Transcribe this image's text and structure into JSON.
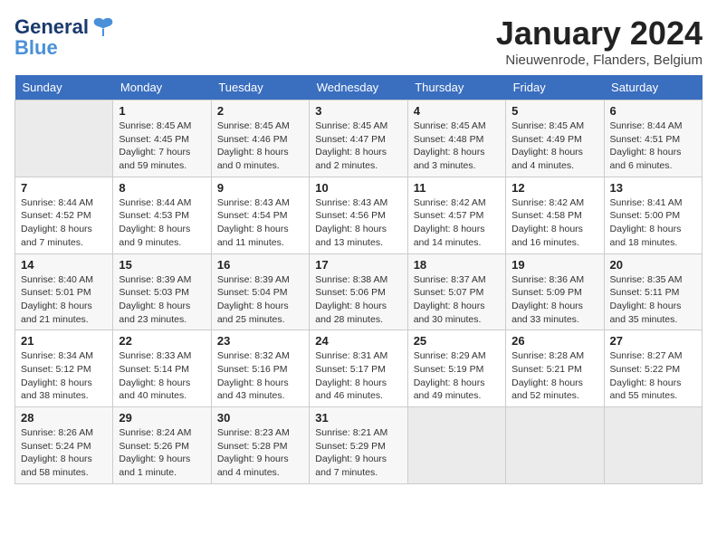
{
  "header": {
    "logo_line1": "General",
    "logo_line2": "Blue",
    "month_title": "January 2024",
    "location": "Nieuwenrode, Flanders, Belgium"
  },
  "days_of_week": [
    "Sunday",
    "Monday",
    "Tuesday",
    "Wednesday",
    "Thursday",
    "Friday",
    "Saturday"
  ],
  "weeks": [
    [
      {
        "num": "",
        "info": ""
      },
      {
        "num": "1",
        "info": "Sunrise: 8:45 AM\nSunset: 4:45 PM\nDaylight: 7 hours\nand 59 minutes."
      },
      {
        "num": "2",
        "info": "Sunrise: 8:45 AM\nSunset: 4:46 PM\nDaylight: 8 hours\nand 0 minutes."
      },
      {
        "num": "3",
        "info": "Sunrise: 8:45 AM\nSunset: 4:47 PM\nDaylight: 8 hours\nand 2 minutes."
      },
      {
        "num": "4",
        "info": "Sunrise: 8:45 AM\nSunset: 4:48 PM\nDaylight: 8 hours\nand 3 minutes."
      },
      {
        "num": "5",
        "info": "Sunrise: 8:45 AM\nSunset: 4:49 PM\nDaylight: 8 hours\nand 4 minutes."
      },
      {
        "num": "6",
        "info": "Sunrise: 8:44 AM\nSunset: 4:51 PM\nDaylight: 8 hours\nand 6 minutes."
      }
    ],
    [
      {
        "num": "7",
        "info": "Sunrise: 8:44 AM\nSunset: 4:52 PM\nDaylight: 8 hours\nand 7 minutes."
      },
      {
        "num": "8",
        "info": "Sunrise: 8:44 AM\nSunset: 4:53 PM\nDaylight: 8 hours\nand 9 minutes."
      },
      {
        "num": "9",
        "info": "Sunrise: 8:43 AM\nSunset: 4:54 PM\nDaylight: 8 hours\nand 11 minutes."
      },
      {
        "num": "10",
        "info": "Sunrise: 8:43 AM\nSunset: 4:56 PM\nDaylight: 8 hours\nand 13 minutes."
      },
      {
        "num": "11",
        "info": "Sunrise: 8:42 AM\nSunset: 4:57 PM\nDaylight: 8 hours\nand 14 minutes."
      },
      {
        "num": "12",
        "info": "Sunrise: 8:42 AM\nSunset: 4:58 PM\nDaylight: 8 hours\nand 16 minutes."
      },
      {
        "num": "13",
        "info": "Sunrise: 8:41 AM\nSunset: 5:00 PM\nDaylight: 8 hours\nand 18 minutes."
      }
    ],
    [
      {
        "num": "14",
        "info": "Sunrise: 8:40 AM\nSunset: 5:01 PM\nDaylight: 8 hours\nand 21 minutes."
      },
      {
        "num": "15",
        "info": "Sunrise: 8:39 AM\nSunset: 5:03 PM\nDaylight: 8 hours\nand 23 minutes."
      },
      {
        "num": "16",
        "info": "Sunrise: 8:39 AM\nSunset: 5:04 PM\nDaylight: 8 hours\nand 25 minutes."
      },
      {
        "num": "17",
        "info": "Sunrise: 8:38 AM\nSunset: 5:06 PM\nDaylight: 8 hours\nand 28 minutes."
      },
      {
        "num": "18",
        "info": "Sunrise: 8:37 AM\nSunset: 5:07 PM\nDaylight: 8 hours\nand 30 minutes."
      },
      {
        "num": "19",
        "info": "Sunrise: 8:36 AM\nSunset: 5:09 PM\nDaylight: 8 hours\nand 33 minutes."
      },
      {
        "num": "20",
        "info": "Sunrise: 8:35 AM\nSunset: 5:11 PM\nDaylight: 8 hours\nand 35 minutes."
      }
    ],
    [
      {
        "num": "21",
        "info": "Sunrise: 8:34 AM\nSunset: 5:12 PM\nDaylight: 8 hours\nand 38 minutes."
      },
      {
        "num": "22",
        "info": "Sunrise: 8:33 AM\nSunset: 5:14 PM\nDaylight: 8 hours\nand 40 minutes."
      },
      {
        "num": "23",
        "info": "Sunrise: 8:32 AM\nSunset: 5:16 PM\nDaylight: 8 hours\nand 43 minutes."
      },
      {
        "num": "24",
        "info": "Sunrise: 8:31 AM\nSunset: 5:17 PM\nDaylight: 8 hours\nand 46 minutes."
      },
      {
        "num": "25",
        "info": "Sunrise: 8:29 AM\nSunset: 5:19 PM\nDaylight: 8 hours\nand 49 minutes."
      },
      {
        "num": "26",
        "info": "Sunrise: 8:28 AM\nSunset: 5:21 PM\nDaylight: 8 hours\nand 52 minutes."
      },
      {
        "num": "27",
        "info": "Sunrise: 8:27 AM\nSunset: 5:22 PM\nDaylight: 8 hours\nand 55 minutes."
      }
    ],
    [
      {
        "num": "28",
        "info": "Sunrise: 8:26 AM\nSunset: 5:24 PM\nDaylight: 8 hours\nand 58 minutes."
      },
      {
        "num": "29",
        "info": "Sunrise: 8:24 AM\nSunset: 5:26 PM\nDaylight: 9 hours\nand 1 minute."
      },
      {
        "num": "30",
        "info": "Sunrise: 8:23 AM\nSunset: 5:28 PM\nDaylight: 9 hours\nand 4 minutes."
      },
      {
        "num": "31",
        "info": "Sunrise: 8:21 AM\nSunset: 5:29 PM\nDaylight: 9 hours\nand 7 minutes."
      },
      {
        "num": "",
        "info": ""
      },
      {
        "num": "",
        "info": ""
      },
      {
        "num": "",
        "info": ""
      }
    ]
  ]
}
